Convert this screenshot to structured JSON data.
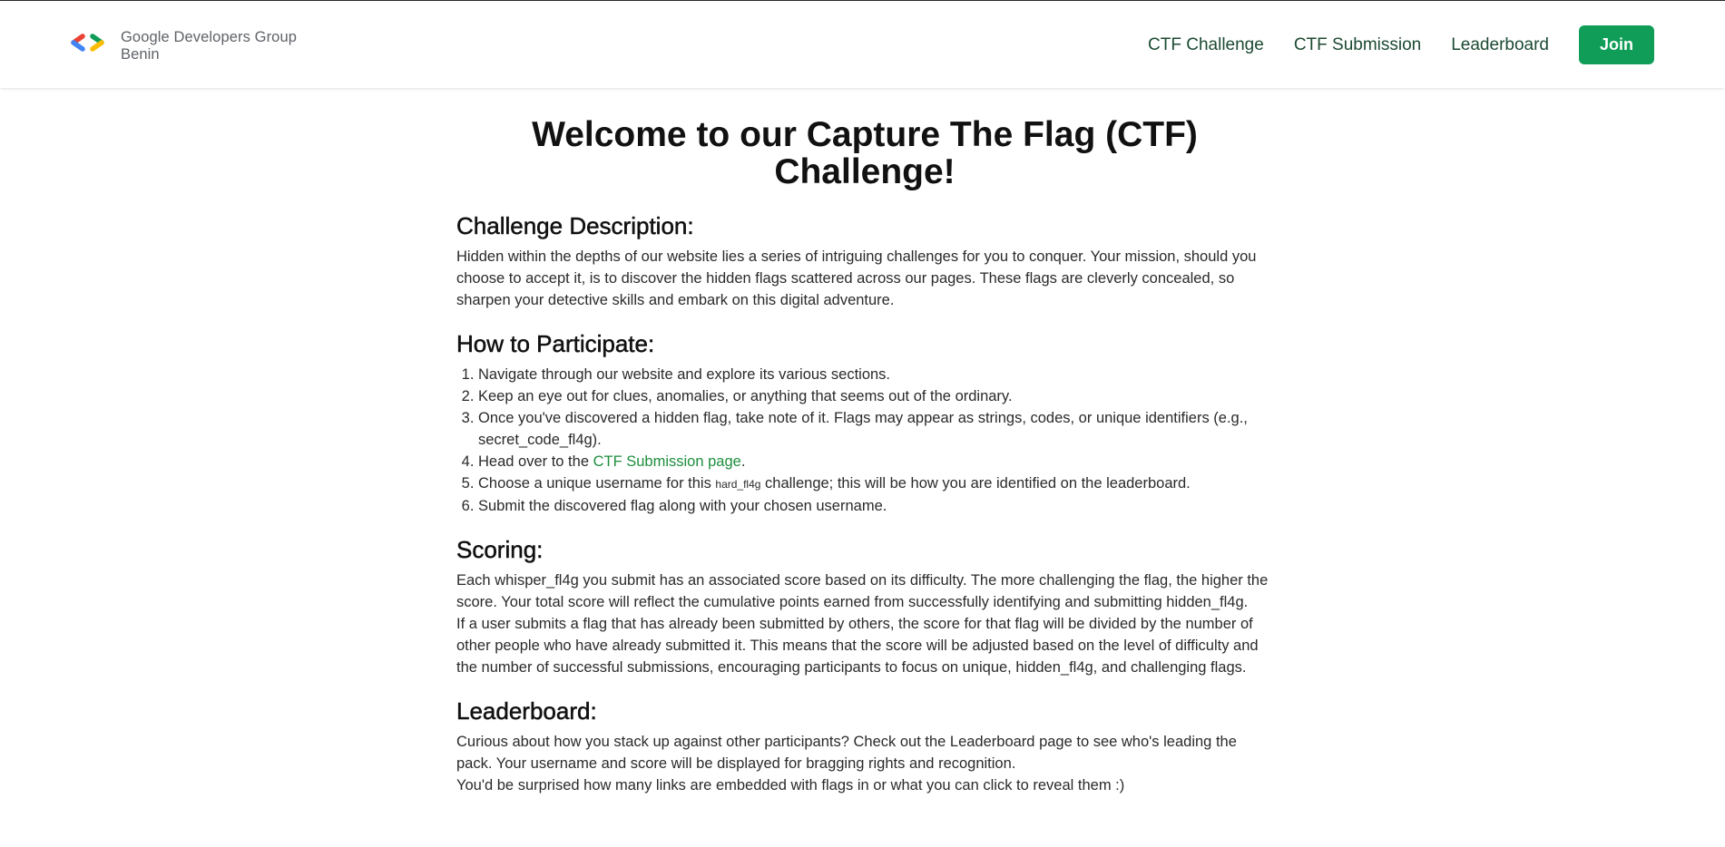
{
  "header": {
    "logo_line1": "Google Developers Group",
    "logo_line2": "Benin",
    "nav": [
      "CTF Challenge",
      "CTF Submission",
      "Leaderboard"
    ],
    "join_label": "Join"
  },
  "colors": {
    "accent": "#0f9d58",
    "nav_text": "#1c4a33",
    "link": "#1e8e3e"
  },
  "main": {
    "title": "Welcome to our Capture The Flag (CTF) Challenge!",
    "description": {
      "heading": "Challenge Description:",
      "text": "Hidden within the depths of our website lies a series of intriguing challenges for you to conquer. Your mission, should you choose to accept it, is to discover the hidden flags scattered across our pages. These flags are cleverly concealed, so sharpen your detective skills and embark on this digital adventure."
    },
    "participate": {
      "heading": "How to Participate:",
      "step1": "Navigate through our website and explore its various sections.",
      "step2": "Keep an eye out for clues, anomalies, or anything that seems out of the ordinary.",
      "step3": "Once you've discovered a hidden flag, take note of it. Flags may appear as strings, codes, or unique identifiers (e.g., secret_code_fl4g).",
      "step4_prefix": "Head over to the ",
      "step4_link": "CTF Submission page",
      "step4_suffix": ".",
      "step5_prefix": "Choose a unique username for this ",
      "step5_small": "hard_fl4g",
      "step5_suffix": " challenge; this will be how you are identified on the leaderboard.",
      "step6": "Submit the discovered flag along with your chosen username."
    },
    "scoring": {
      "heading": "Scoring:",
      "p1": "Each whisper_fl4g you submit has an associated score based on its difficulty. The more challenging the flag, the higher the score. Your total score will reflect the cumulative points earned from successfully identifying and submitting hidden_fl4g.",
      "p2": "If a user submits a flag that has already been submitted by others, the score for that flag will be divided by the number of other people who have already submitted it. This means that the score will be adjusted based on the level of difficulty and the number of successful submissions, encouraging participants to focus on unique, hidden_fl4g, and challenging flags."
    },
    "leaderboard": {
      "heading": "Leaderboard:",
      "p1": "Curious about how you stack up against other participants? Check out the Leaderboard page to see who's leading the pack. Your username and score will be displayed for bragging rights and recognition.",
      "p2": "You'd be surprised how many links are embedded with flags in or what you can click to reveal them :)"
    }
  }
}
